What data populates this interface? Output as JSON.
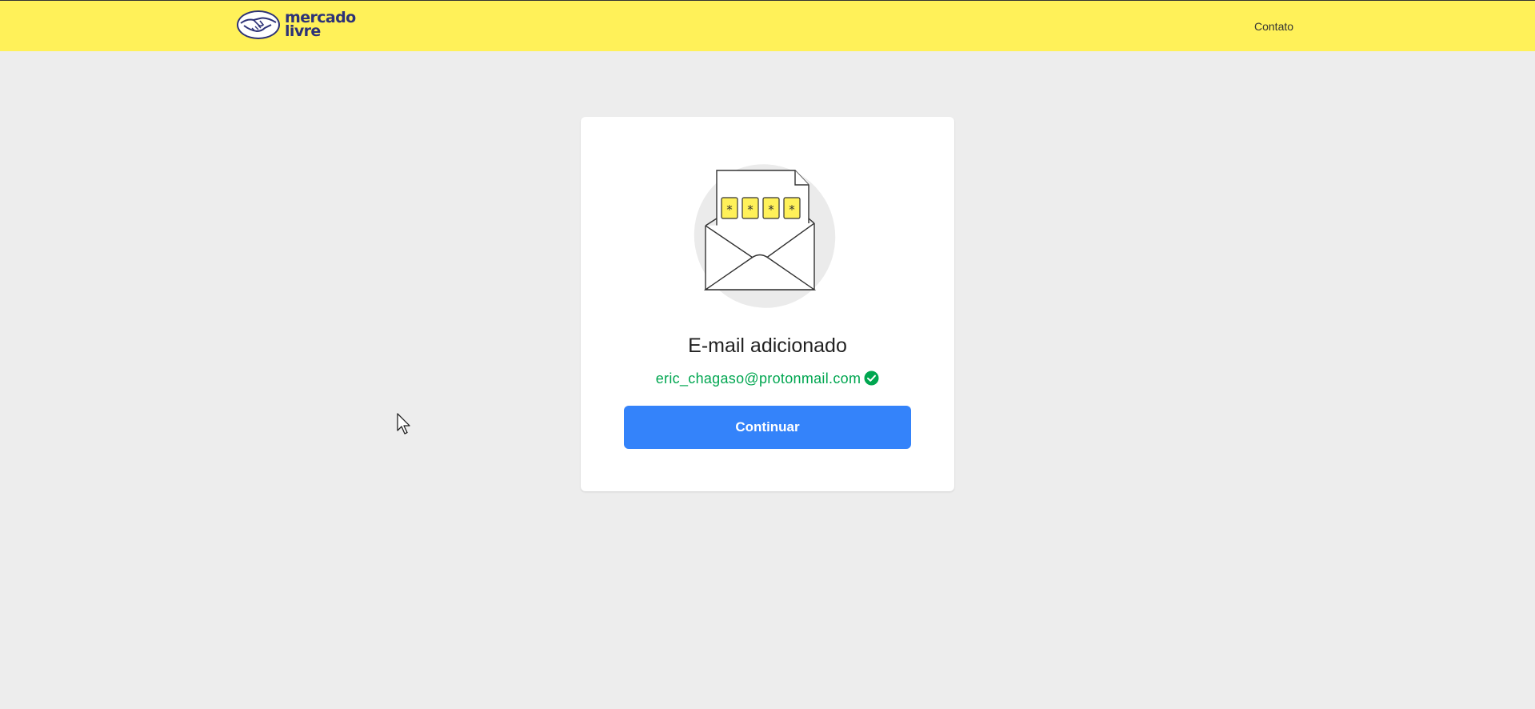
{
  "header": {
    "logo": {
      "line1": "mercado",
      "line2": "livre",
      "brand_color": "#2d3277"
    },
    "contact_label": "Contato",
    "background": "#fff159"
  },
  "card": {
    "title": "E-mail adicionado",
    "email": "eric_chagaso@protonmail.com",
    "email_status_icon": "check-circle-icon",
    "continue_label": "Continuar",
    "code_chars": [
      "*",
      "*",
      "*",
      "*"
    ],
    "accent": "#3483fa",
    "success_color": "#00a650"
  }
}
